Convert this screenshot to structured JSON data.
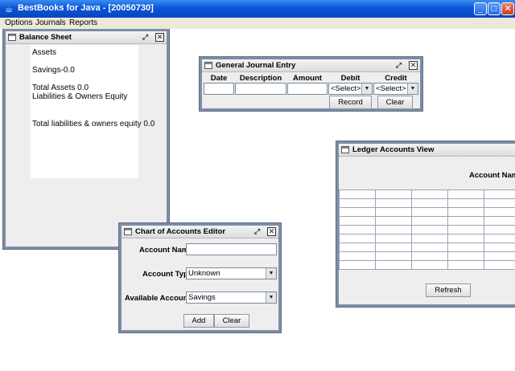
{
  "app": {
    "title": "BestBooks for Java - [20050730]",
    "icon": "coffee-cup-icon",
    "window_buttons": {
      "minimize": "_",
      "maximize": "□",
      "close": "✕"
    }
  },
  "menu": {
    "items": [
      "Options",
      "Journals",
      "Reports"
    ]
  },
  "balance_sheet": {
    "title": "Balance Sheet",
    "lines": [
      "Assets",
      "Savings-0.0",
      "Total Assets 0.0",
      "Liabilities & Owners Equity",
      "Total liabilities & owners equity 0.0"
    ]
  },
  "journal_entry": {
    "title": "General Journal Entry",
    "columns": [
      "Date",
      "Description",
      "Amount",
      "Debit",
      "Credit"
    ],
    "debit_selected": "<Select>",
    "credit_selected": "<Select>",
    "record_label": "Record",
    "clear_label": "Clear"
  },
  "ledger": {
    "title": "Ledger Accounts View",
    "account_name_label": "Account Nam",
    "refresh_label": "Refresh"
  },
  "accounts_editor": {
    "title": "Chart of Accounts Editor",
    "account_name_label": "Account Name",
    "account_name_value": "",
    "account_type_label": "Account Type",
    "account_type_selected": "Unknown",
    "available_accounts_label": "Available Accounts",
    "available_accounts_selected": "Savings",
    "add_label": "Add",
    "clear_label": "Clear"
  },
  "colors": {
    "titlebar": "#0a55d8",
    "frame_border": "#7b8ea6",
    "frame_bg": "#eeeeee",
    "menubar": "#ece9d8"
  }
}
